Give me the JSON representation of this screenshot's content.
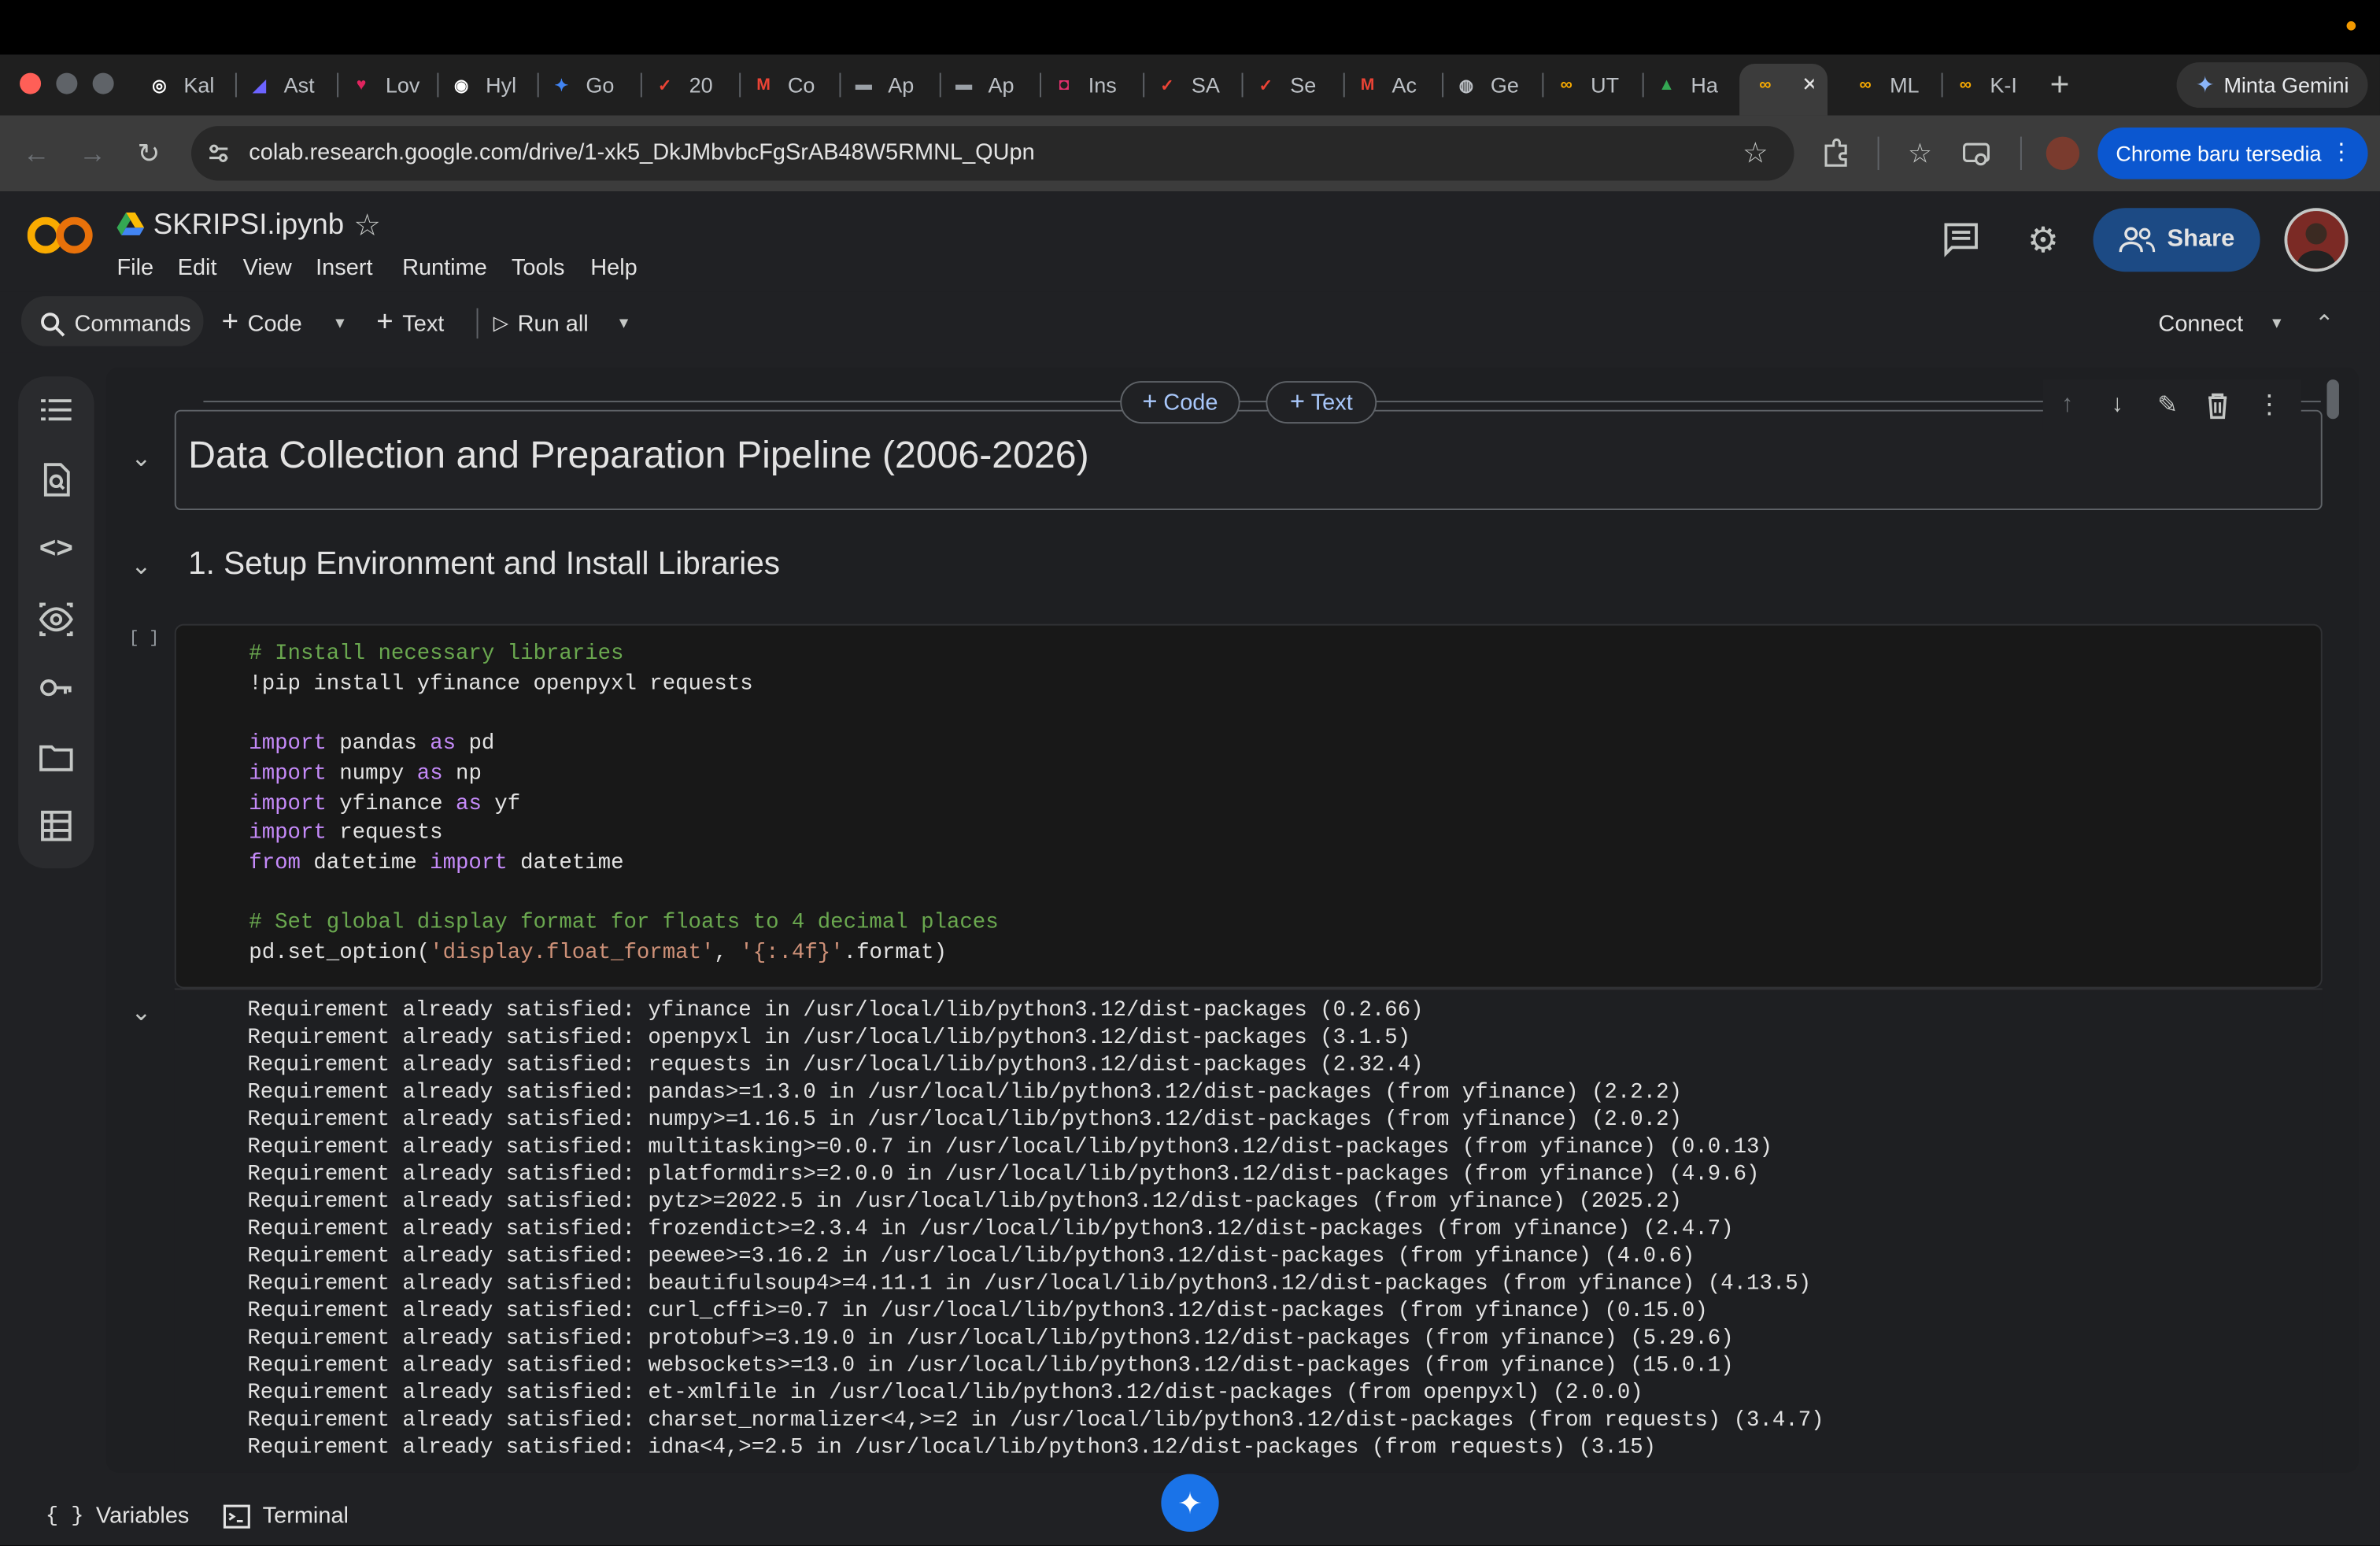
{
  "browser": {
    "tabs": [
      {
        "label": "Kal",
        "icon": "chatgpt-icon",
        "color": "#ffffff"
      },
      {
        "label": "Ast",
        "icon": "astro-icon",
        "color": "#6c63ff"
      },
      {
        "label": "Lov",
        "icon": "lovable-icon",
        "color": "#e0245e"
      },
      {
        "label": "Hyl",
        "icon": "hylo-icon",
        "color": "#ffffff"
      },
      {
        "label": "Go",
        "icon": "gemini-icon",
        "color": "#4285f4"
      },
      {
        "label": "20",
        "icon": "red-check-icon",
        "color": "#ea4335"
      },
      {
        "label": "Co",
        "icon": "gmail-icon",
        "color": "#ea4335"
      },
      {
        "label": "Ap",
        "icon": "app-icon",
        "color": "#9aa0a6"
      },
      {
        "label": "Ap",
        "icon": "app-icon",
        "color": "#9aa0a6"
      },
      {
        "label": "Ins",
        "icon": "instagram-icon",
        "color": "#e1306c"
      },
      {
        "label": "SA",
        "icon": "red-check-icon",
        "color": "#ea4335"
      },
      {
        "label": "Se",
        "icon": "red-check-icon",
        "color": "#ea4335"
      },
      {
        "label": "Ac",
        "icon": "gmail-icon",
        "color": "#ea4335"
      },
      {
        "label": "Ge",
        "icon": "globe-icon",
        "color": "#bdc1c6"
      },
      {
        "label": "UT",
        "icon": "colab-icon",
        "color": "#f9ab00"
      },
      {
        "label": "Ha",
        "icon": "drive-icon",
        "color": "#34a853"
      },
      {
        "label": "",
        "icon": "colab-icon",
        "color": "#f9ab00"
      },
      {
        "label": "ML",
        "icon": "colab-icon",
        "color": "#f9ab00"
      },
      {
        "label": "K-I",
        "icon": "colab-icon",
        "color": "#f9ab00"
      }
    ],
    "gemini_button": "Minta Gemini",
    "url": "colab.research.google.com/drive/1-xk5_DkJMbvbcFgSrAB48W5RMNL_QUpn",
    "update_button": "Chrome baru tersedia"
  },
  "colab": {
    "notebook_title": "SKRIPSI.ipynb",
    "menu": [
      "File",
      "Edit",
      "View",
      "Insert",
      "Runtime",
      "Tools",
      "Help"
    ],
    "share_label": "Share",
    "toolbar": {
      "commands": "Commands",
      "code": "Code",
      "text": "Text",
      "run_all": "Run all",
      "connect": "Connect"
    },
    "cell_add": {
      "code": "Code",
      "text": "Text"
    }
  },
  "notebook": {
    "heading1": "Data Collection and Preparation Pipeline (2006-2026)",
    "heading2": "1. Setup Environment and Install Libraries",
    "exec_bracket": "[ ]",
    "code_lines": [
      "# Install necessary libraries",
      "!pip install yfinance openpyxl requests",
      "",
      "import pandas as pd",
      "import numpy as np",
      "import yfinance as yf",
      "import requests",
      "from datetime import datetime",
      "",
      "# Set global display format for floats to 4 decimal places",
      "pd.set_option('display.float_format', '{:.4f}'.format)"
    ],
    "output_lines": [
      "Requirement already satisfied: yfinance in /usr/local/lib/python3.12/dist-packages (0.2.66)",
      "Requirement already satisfied: openpyxl in /usr/local/lib/python3.12/dist-packages (3.1.5)",
      "Requirement already satisfied: requests in /usr/local/lib/python3.12/dist-packages (2.32.4)",
      "Requirement already satisfied: pandas>=1.3.0 in /usr/local/lib/python3.12/dist-packages (from yfinance) (2.2.2)",
      "Requirement already satisfied: numpy>=1.16.5 in /usr/local/lib/python3.12/dist-packages (from yfinance) (2.0.2)",
      "Requirement already satisfied: multitasking>=0.0.7 in /usr/local/lib/python3.12/dist-packages (from yfinance) (0.0.13)",
      "Requirement already satisfied: platformdirs>=2.0.0 in /usr/local/lib/python3.12/dist-packages (from yfinance) (4.9.6)",
      "Requirement already satisfied: pytz>=2022.5 in /usr/local/lib/python3.12/dist-packages (from yfinance) (2025.2)",
      "Requirement already satisfied: frozendict>=2.3.4 in /usr/local/lib/python3.12/dist-packages (from yfinance) (2.4.7)",
      "Requirement already satisfied: peewee>=3.16.2 in /usr/local/lib/python3.12/dist-packages (from yfinance) (4.0.6)",
      "Requirement already satisfied: beautifulsoup4>=4.11.1 in /usr/local/lib/python3.12/dist-packages (from yfinance) (4.13.5)",
      "Requirement already satisfied: curl_cffi>=0.7 in /usr/local/lib/python3.12/dist-packages (from yfinance) (0.15.0)",
      "Requirement already satisfied: protobuf>=3.19.0 in /usr/local/lib/python3.12/dist-packages (from yfinance) (5.29.6)",
      "Requirement already satisfied: websockets>=13.0 in /usr/local/lib/python3.12/dist-packages (from yfinance) (15.0.1)",
      "Requirement already satisfied: et-xmlfile in /usr/local/lib/python3.12/dist-packages (from openpyxl) (2.0.0)",
      "Requirement already satisfied: charset_normalizer<4,>=2 in /usr/local/lib/python3.12/dist-packages (from requests) (3.4.7)",
      "Requirement already satisfied: idna<4,>=2.5 in /usr/local/lib/python3.12/dist-packages (from requests) (3.15)"
    ]
  },
  "bottom": {
    "variables": "Variables",
    "terminal": "Terminal"
  },
  "colors": {
    "accent": "#a8c7fa",
    "share_bg": "#1c4a84",
    "update_bg": "#0b57d0",
    "comment": "#6aa84f",
    "keyword": "#c58af9",
    "string": "#ce9178"
  }
}
